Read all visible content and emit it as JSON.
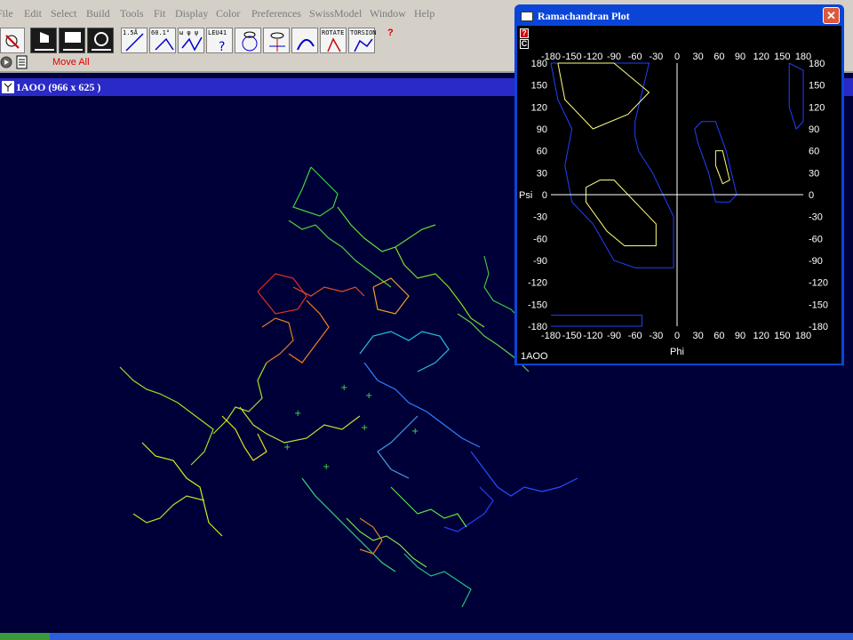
{
  "menubar": {
    "items": [
      "File",
      "Edit",
      "Select",
      "Build",
      "Tools",
      "Fit",
      "Display",
      "Color",
      "Preferences",
      "SwissModel",
      "Window",
      "Help"
    ]
  },
  "toolbar": {
    "measure_distance": "1.5Å",
    "measure_angle": "60.1°",
    "measure_dihedral": "ω φ ψ",
    "identify": "LEU41",
    "rotate": "ROTATE",
    "torsion": "TORSION",
    "help": "?"
  },
  "subbar": {
    "move_all_label": "Move All"
  },
  "structure_window": {
    "title": "1AOO   (966 x 625 )"
  },
  "ramachandran": {
    "window_title": "Ramachandran Plot",
    "help_button": "?",
    "c_button": "C",
    "structure_label": "1AOO",
    "colors": {
      "favored": "#ffff80",
      "allowed": "#2040ff",
      "axes": "#ffffff"
    }
  },
  "chart_data": {
    "type": "scatter",
    "title": "",
    "xlabel": "Phi",
    "ylabel": "Psi",
    "xlim": [
      -180,
      180
    ],
    "ylim": [
      -180,
      180
    ],
    "x_ticks": [
      "-180",
      "-150",
      "-120",
      "-90",
      "-60",
      "-30",
      "0",
      "30",
      "60",
      "90",
      "120",
      "150",
      "180"
    ],
    "y_ticks": [
      "180",
      "150",
      "120",
      "90",
      "60",
      "30",
      "0",
      "-30",
      "-60",
      "-90",
      "-120",
      "-150",
      "-180"
    ],
    "contours": [
      {
        "level": "allowed",
        "points": [
          [
            -180,
            180
          ],
          [
            -40,
            180
          ],
          [
            -50,
            140
          ],
          [
            -60,
            100
          ],
          [
            -60,
            80
          ],
          [
            -55,
            60
          ],
          [
            -35,
            30
          ],
          [
            -5,
            -30
          ],
          [
            -5,
            -100
          ],
          [
            -60,
            -100
          ],
          [
            -90,
            -90
          ],
          [
            -120,
            -40
          ],
          [
            -150,
            -10
          ],
          [
            -160,
            40
          ],
          [
            -150,
            90
          ],
          [
            -170,
            130
          ],
          [
            -180,
            180
          ]
        ]
      },
      {
        "level": "allowed",
        "points": [
          [
            25,
            90
          ],
          [
            35,
            100
          ],
          [
            55,
            100
          ],
          [
            70,
            60
          ],
          [
            85,
            0
          ],
          [
            75,
            -10
          ],
          [
            55,
            -10
          ],
          [
            45,
            30
          ],
          [
            30,
            70
          ],
          [
            25,
            90
          ]
        ]
      },
      {
        "level": "allowed",
        "points": [
          [
            -180,
            -165
          ],
          [
            -50,
            -165
          ],
          [
            -50,
            -180
          ],
          [
            -180,
            -180
          ]
        ]
      },
      {
        "level": "allowed",
        "points": [
          [
            160,
            180
          ],
          [
            180,
            170
          ],
          [
            180,
            100
          ],
          [
            170,
            90
          ],
          [
            160,
            120
          ],
          [
            160,
            180
          ]
        ]
      },
      {
        "level": "favored",
        "points": [
          [
            -170,
            180
          ],
          [
            -90,
            180
          ],
          [
            -40,
            140
          ],
          [
            -70,
            110
          ],
          [
            -120,
            90
          ],
          [
            -160,
            130
          ],
          [
            -170,
            180
          ]
        ]
      },
      {
        "level": "favored",
        "points": [
          [
            -130,
            10
          ],
          [
            -110,
            20
          ],
          [
            -90,
            20
          ],
          [
            -30,
            -40
          ],
          [
            -30,
            -70
          ],
          [
            -75,
            -70
          ],
          [
            -100,
            -50
          ],
          [
            -130,
            -10
          ],
          [
            -130,
            10
          ]
        ]
      },
      {
        "level": "favored",
        "points": [
          [
            55,
            60
          ],
          [
            65,
            60
          ],
          [
            75,
            20
          ],
          [
            65,
            15
          ],
          [
            55,
            40
          ],
          [
            55,
            60
          ]
        ]
      }
    ]
  }
}
